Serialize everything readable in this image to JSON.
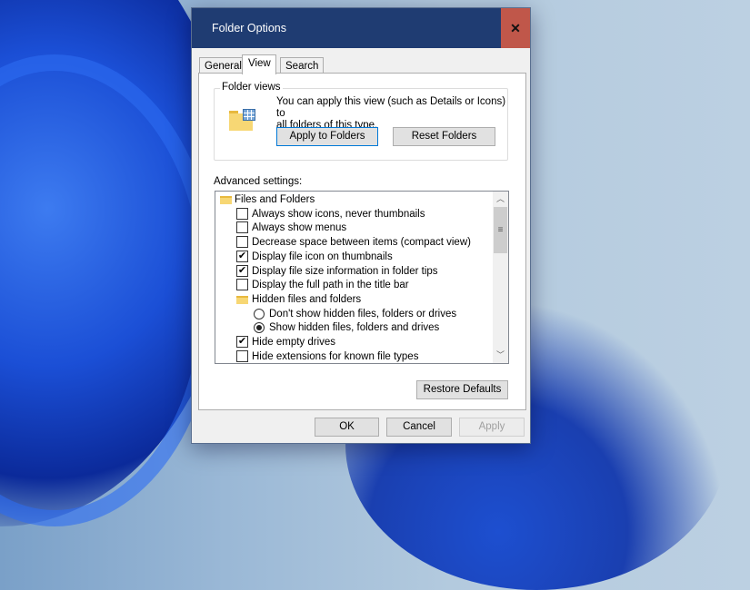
{
  "dialog": {
    "title": "Folder Options",
    "close": "✕"
  },
  "tabs": [
    "General",
    "View",
    "Search"
  ],
  "folder_views": {
    "label": "Folder views",
    "description_line1": "You can apply this view (such as Details or Icons) to",
    "description_line2": "all folders of this type.",
    "apply_button": "Apply to Folders",
    "reset_button": "Reset Folders"
  },
  "advanced": {
    "label": "Advanced settings:",
    "items": [
      {
        "type": "folder",
        "text": "Files and Folders"
      },
      {
        "type": "check",
        "checked": false,
        "text": "Always show icons, never thumbnails"
      },
      {
        "type": "check",
        "checked": false,
        "text": "Always show menus"
      },
      {
        "type": "check",
        "checked": false,
        "text": "Decrease space between items (compact view)"
      },
      {
        "type": "check",
        "checked": true,
        "text": "Display file icon on thumbnails"
      },
      {
        "type": "check",
        "checked": true,
        "text": "Display file size information in folder tips"
      },
      {
        "type": "check",
        "checked": false,
        "text": "Display the full path in the title bar"
      },
      {
        "type": "subfolder",
        "text": "Hidden files and folders"
      },
      {
        "type": "radio",
        "checked": false,
        "text": "Don't show hidden files, folders or drives"
      },
      {
        "type": "radio",
        "checked": true,
        "text": "Show hidden files, folders and drives"
      },
      {
        "type": "check",
        "checked": true,
        "text": "Hide empty drives"
      },
      {
        "type": "check",
        "checked": false,
        "text": "Hide extensions for known file types"
      }
    ]
  },
  "restore_defaults": "Restore Defaults",
  "footer": {
    "ok": "OK",
    "cancel": "Cancel",
    "apply": "Apply"
  }
}
